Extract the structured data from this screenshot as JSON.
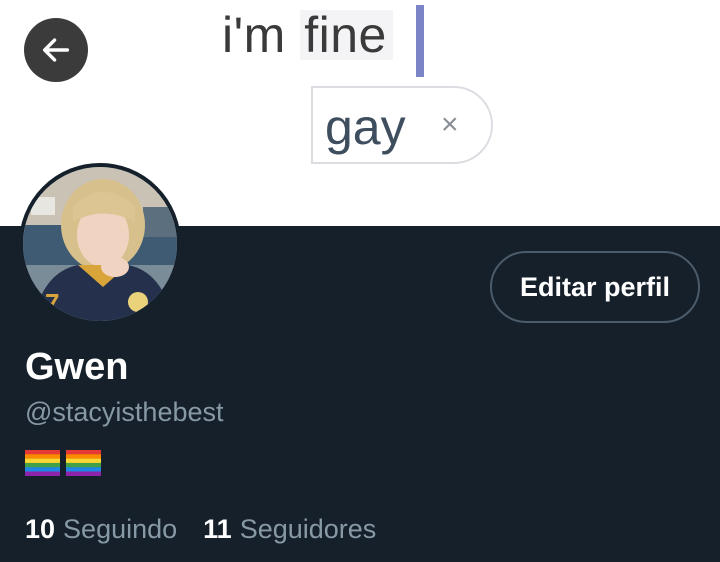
{
  "banner": {
    "line1_prefix": "i'm ",
    "line1_highlight": "fine",
    "tag_label": "gay",
    "tag_close": "×"
  },
  "header": {
    "back_icon": "arrow-left-icon"
  },
  "profile": {
    "edit_label": "Editar perfil",
    "name": "Gwen",
    "handle": "@stacyisthebest",
    "bio_icons": [
      "rainbow-flag-icon",
      "rainbow-flag-icon"
    ],
    "following_count": "10",
    "following_label": "Seguindo",
    "followers_count": "11",
    "followers_label": "Seguidores"
  },
  "colors": {
    "background": "#15202b",
    "secondary_text": "#8899a6",
    "border": "#4b5b6a"
  }
}
